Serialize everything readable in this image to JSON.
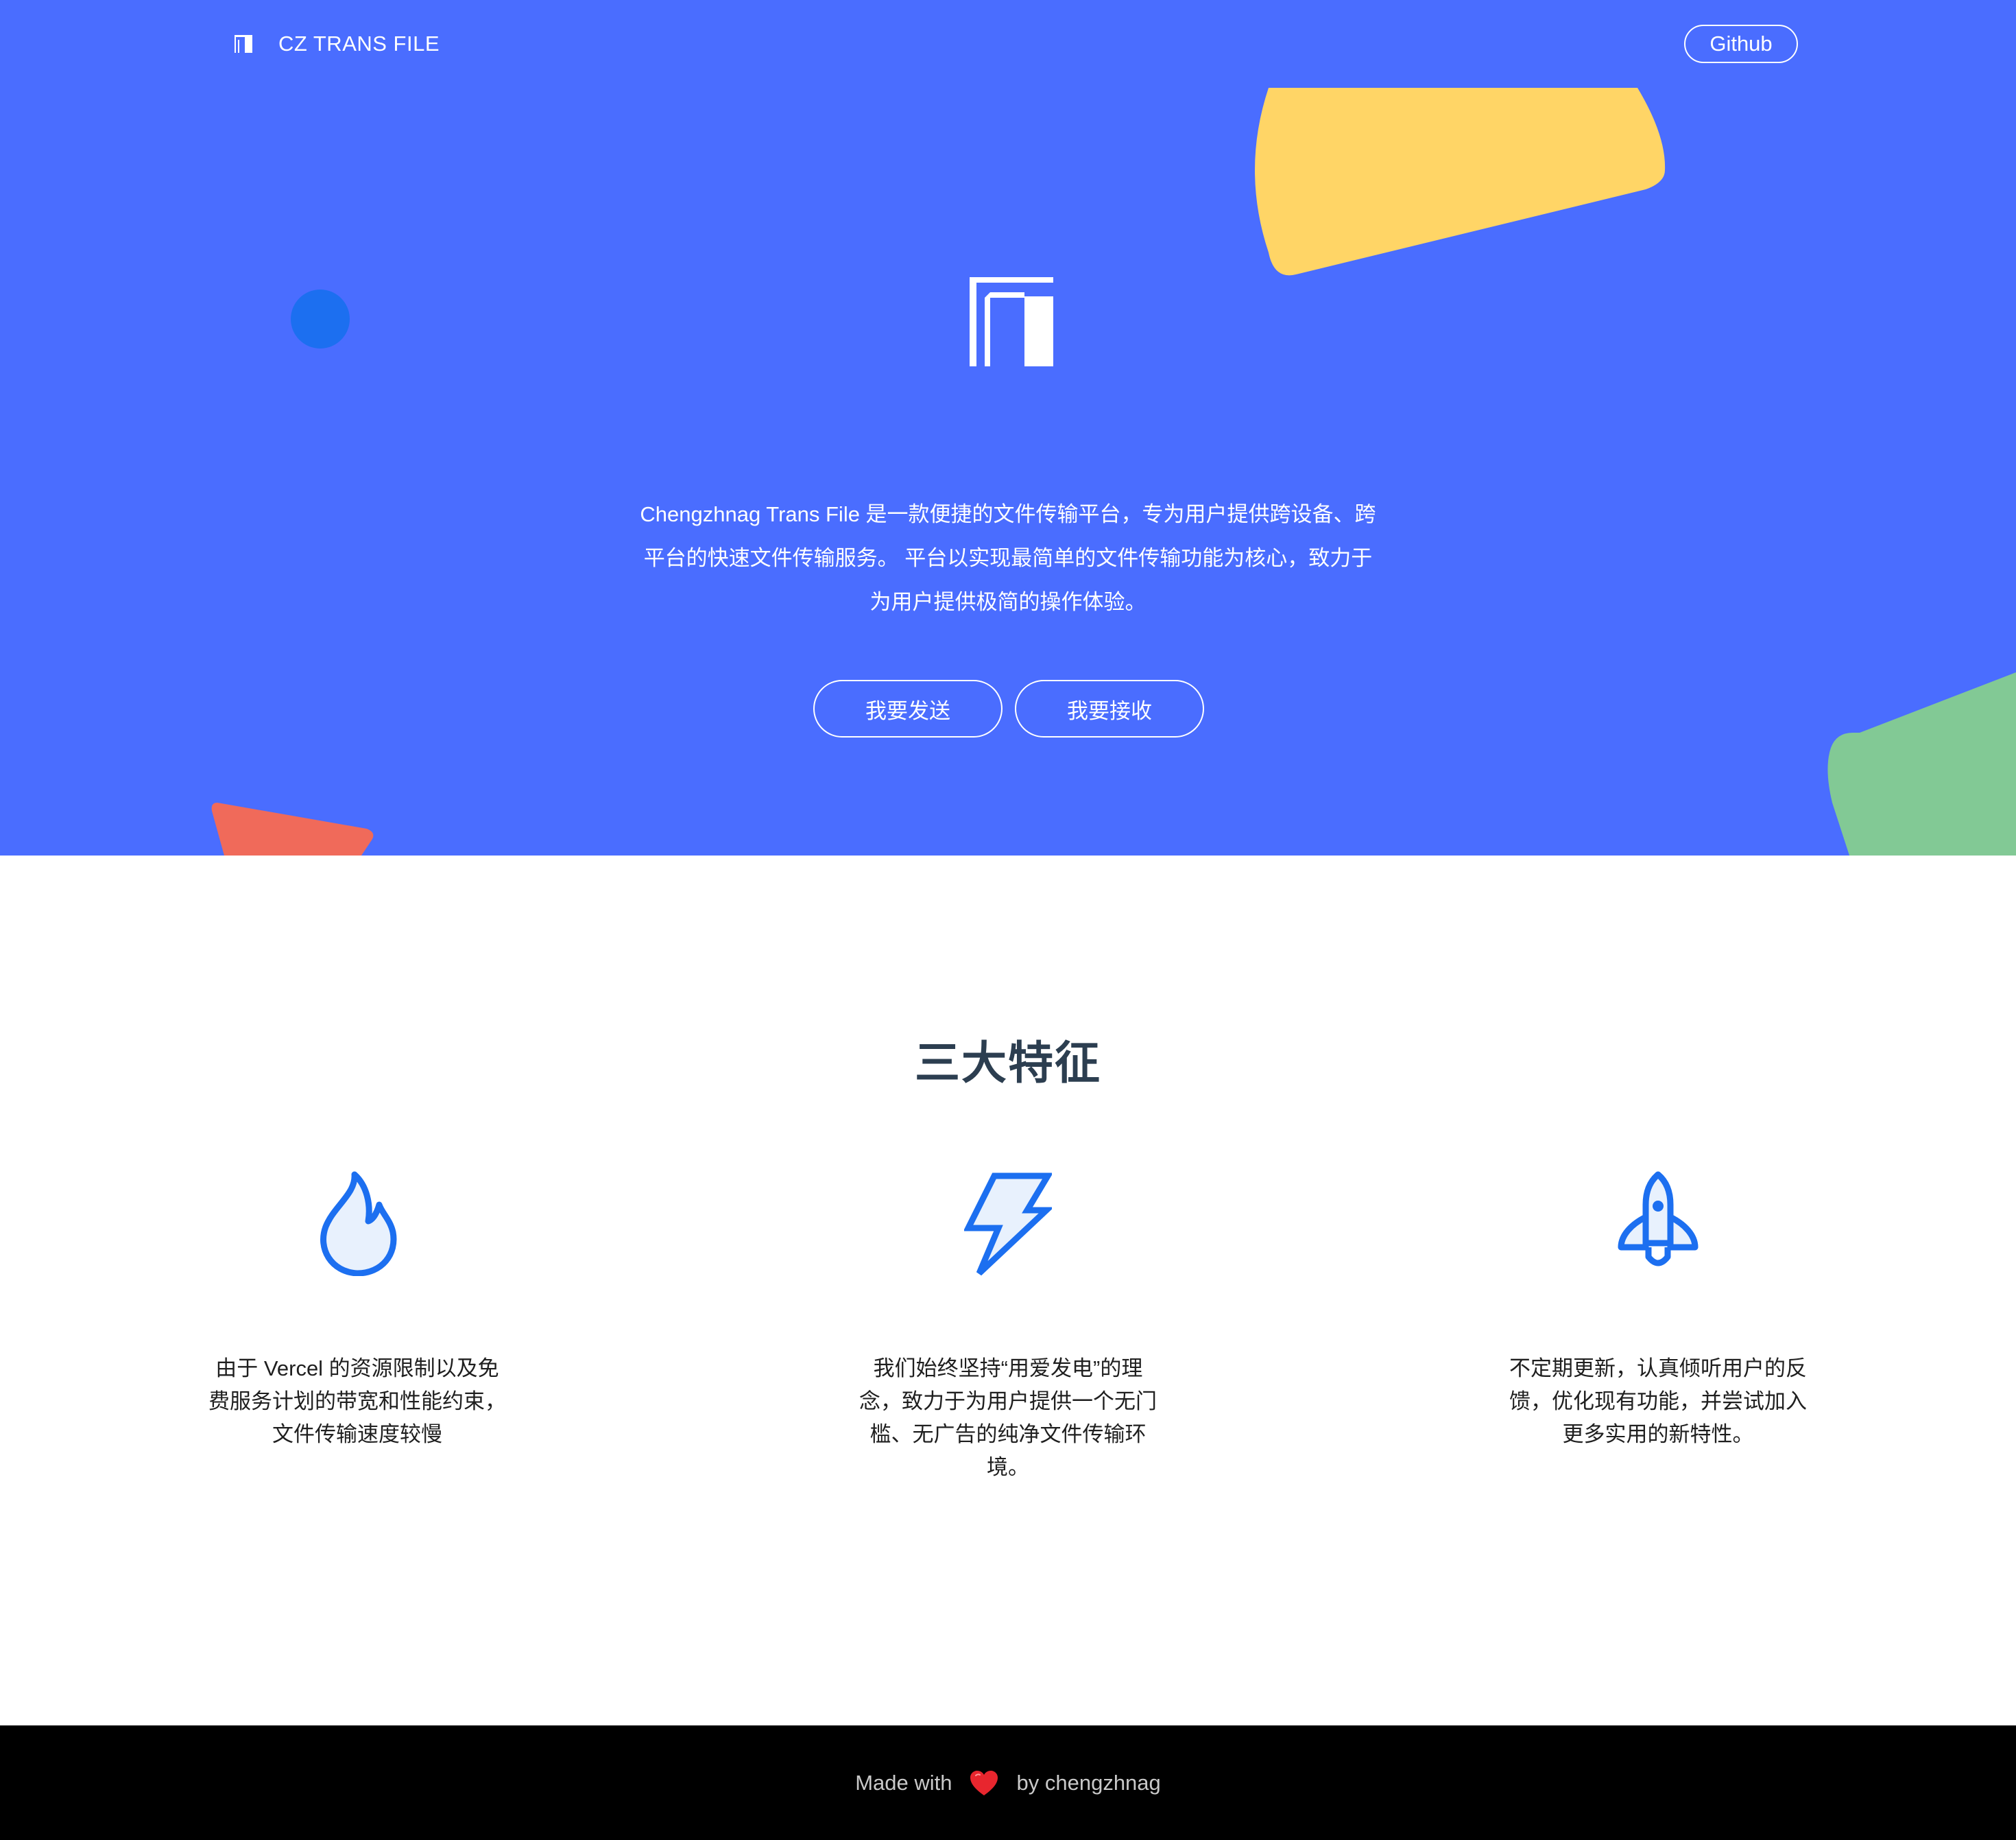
{
  "colors": {
    "hero_bg": "#4a6dff",
    "yellow_shape": "#ffd566",
    "dot_shape": "#1c6ff0",
    "red_shape": "#f06a5a",
    "green_shape": "#82c995",
    "icon_blue": "#1c6ff0",
    "title_color": "#2c3e50",
    "footer_bg": "#000000"
  },
  "nav": {
    "logo_icon": "cz-logo-icon",
    "title": "CZ TRANS FILE",
    "github_label": "Github"
  },
  "hero": {
    "logo_icon": "cz-logo-icon",
    "description": [
      "Chengzhnag Trans File 是一款便捷的文件传输平台，专为用户提供跨设备、跨",
      "平台的快速文件传输服务。 平台以实现最简单的文件传输功能为核心，致力于",
      "为用户提供极简的操作体验。"
    ],
    "send_button": "我要发送",
    "receive_button": "我要接收"
  },
  "features": {
    "title": "三大特征",
    "items": [
      {
        "icon": "flame-icon",
        "lines": [
          "由于 Vercel 的资源限制以及免",
          "费服务计划的带宽和性能约束，",
          "文件传输速度较慢"
        ]
      },
      {
        "icon": "lightning-icon",
        "lines": [
          "我们始终坚持“用爱发电”的理",
          "念，致力于为用户提供一个无门",
          "槛、无广告的纯净文件传输环",
          "境。"
        ]
      },
      {
        "icon": "rocket-icon",
        "lines": [
          "不定期更新，认真倾听用户的反",
          "馈，优化现有功能，并尝试加入",
          "更多实用的新特性。"
        ]
      }
    ]
  },
  "footer": {
    "made_with": "Made with",
    "heart_icon": "heart-icon",
    "by_author": "by chengzhnag"
  }
}
